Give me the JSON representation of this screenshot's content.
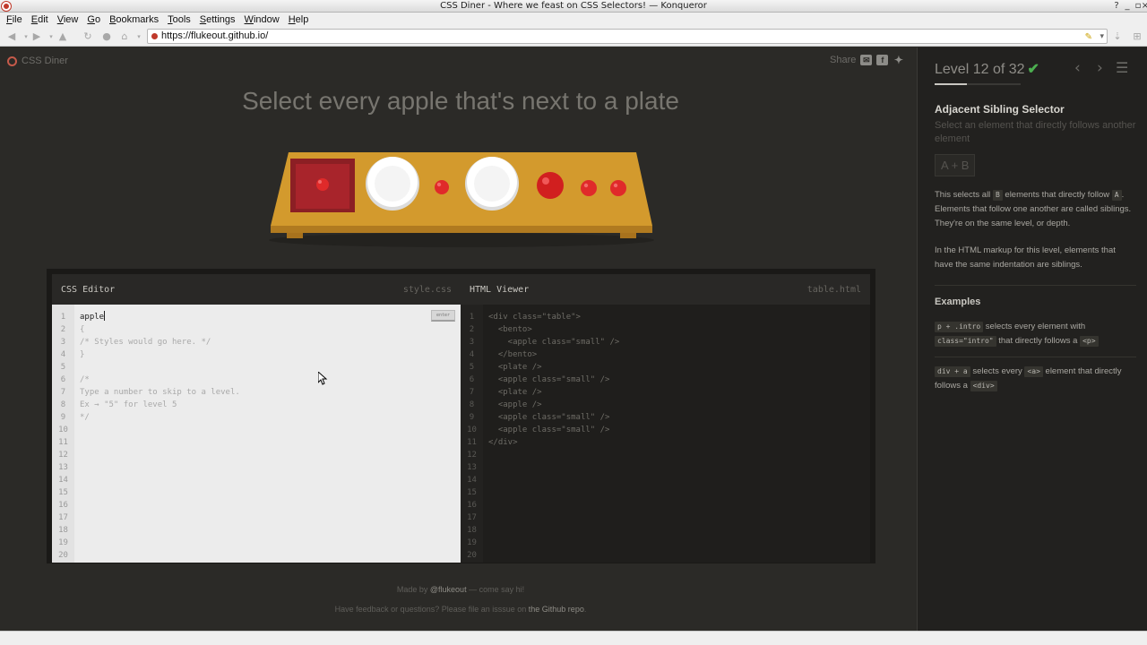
{
  "window": {
    "title": "CSS Diner - Where we feast on CSS Selectors! — Konqueror"
  },
  "menu": [
    "File",
    "Edit",
    "View",
    "Go",
    "Bookmarks",
    "Tools",
    "Settings",
    "Window",
    "Help"
  ],
  "toolbar": {
    "url": "https://flukeout.github.io/"
  },
  "header": {
    "logo": "CSS Diner",
    "share": "Share"
  },
  "game": {
    "instruction": "Select every apple that's next to a plate"
  },
  "css_editor": {
    "title": "CSS Editor",
    "file": "style.css",
    "enter_label": "enter",
    "typed": "apple",
    "lines": [
      "{",
      "/* Styles would go here. */",
      "}",
      "",
      "/*",
      "Type a number to skip to a level.",
      "Ex → \"5\" for level 5",
      "*/"
    ],
    "line_numbers": [
      "1",
      "2",
      "3",
      "4",
      "5",
      "6",
      "7",
      "8",
      "9",
      "10",
      "11",
      "12",
      "13",
      "14",
      "15",
      "16",
      "17",
      "18",
      "19",
      "20"
    ]
  },
  "html_viewer": {
    "title": "HTML Viewer",
    "file": "table.html",
    "lines": [
      "<div class=\"table\">",
      "  <bento>",
      "    <apple class=\"small\" />",
      "  </bento>",
      "  <plate />",
      "  <apple class=\"small\" />",
      "  <plate />",
      "  <apple />",
      "  <apple class=\"small\" />",
      "  <apple class=\"small\" />",
      "</div>"
    ],
    "line_numbers": [
      "1",
      "2",
      "3",
      "4",
      "5",
      "6",
      "7",
      "8",
      "9",
      "10",
      "11",
      "12",
      "13",
      "14",
      "15",
      "16",
      "17",
      "18",
      "19",
      "20"
    ]
  },
  "footer": {
    "made_by_prefix": "Made by ",
    "made_by_link": "@flukeout",
    "made_by_suffix": " — come say hi!",
    "feedback_prefix": "Have feedback or questions? Please file an isssue on ",
    "feedback_link": "the Github repo",
    "feedback_suffix": "."
  },
  "sidebar": {
    "level": "Level 12 of 32",
    "level_progress": 0.375,
    "selector_name": "Adjacent Sibling Selector",
    "selector_desc": "Select an element that directly follows another element",
    "syntax": "A + B",
    "desc1_a": "This selects all ",
    "desc1_tag_b": "B",
    "desc1_b": " elements that directly follow ",
    "desc1_tag_a": "A",
    "desc1_c": ". Elements that follow one another are called siblings. They're on the same level, or depth.",
    "desc2": "In the HTML markup for this level, elements that have the same indentation are siblings.",
    "examples_title": "Examples",
    "ex1_code": "p + .intro",
    "ex1_a": " selects every element with ",
    "ex1_code2": "class=\"intro\"",
    "ex1_b": " that directly follows a ",
    "ex1_tag": "<p>",
    "ex2_code": "div + a",
    "ex2_a": " selects every ",
    "ex2_tag": "<a>",
    "ex2_b": " element that directly follows a ",
    "ex2_tag2": "<div>"
  },
  "colors": {
    "accent_check": "#4caf50",
    "apple": "#e02a2a",
    "table": "#d39a2d",
    "bento": "#a8242b"
  }
}
